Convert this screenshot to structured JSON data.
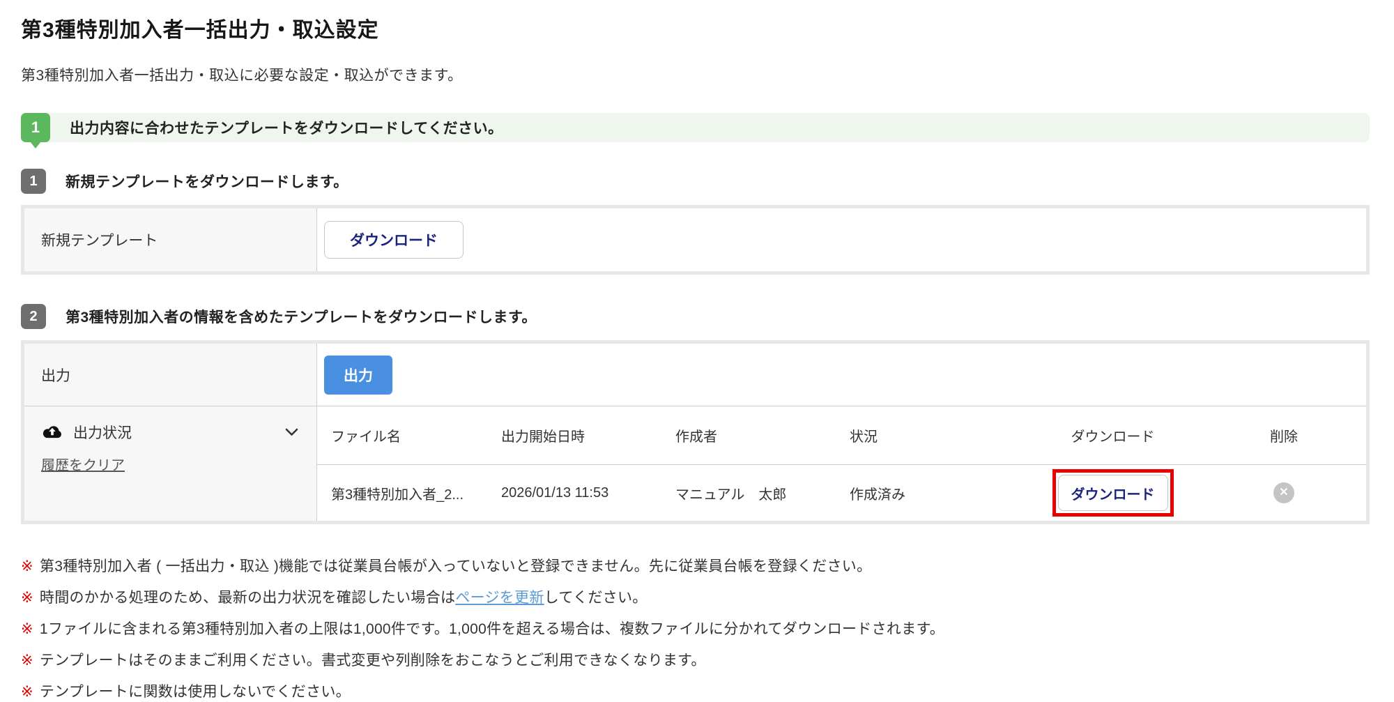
{
  "page": {
    "title": "第3種特別加入者一括出力・取込設定",
    "subtitle": "第3種特別加入者一括出力・取込に必要な設定・取込ができます。"
  },
  "banner": {
    "step": "1",
    "text": "出力内容に合わせたテンプレートをダウンロードしてください。"
  },
  "section1": {
    "num": "1",
    "heading": "新規テンプレートをダウンロードします。",
    "label": "新規テンプレート",
    "download_button": "ダウンロード"
  },
  "section2": {
    "num": "2",
    "heading": "第3種特別加入者の情報を含めたテンプレートをダウンロードします。",
    "output_label": "出力",
    "output_button": "出力",
    "status_label": "出力状況",
    "clear_history_link": "履歴をクリア",
    "table": {
      "headers": [
        "ファイル名",
        "出力開始日時",
        "作成者",
        "状況",
        "ダウンロード",
        "削除"
      ],
      "row": {
        "file_name": "第3種特別加入者_2...",
        "started_at": "2026/01/13 11:53",
        "creator": "マニュアル　太郎",
        "status": "作成済み",
        "download_button": "ダウンロード",
        "delete_glyph": "✕"
      }
    }
  },
  "notes": {
    "marker": "※",
    "note1": "第3種特別加入者 ( 一括出力・取込 )機能では従業員台帳が入っていないと登録できません。先に従業員台帳を登録ください。",
    "note2_pre": "時間のかかる処理のため、最新の出力状況を確認したい場合は",
    "note2_link": "ページを更新",
    "note2_post": "してください。",
    "note3": "1ファイルに含まれる第3種特別加入者の上限は1,000件です。1,000件を超える場合は、複数ファイルに分かれてダウンロードされます。",
    "note4": "テンプレートはそのままご利用ください。書式変更や列削除をおこなうとご利用できなくなります。",
    "note5": "テンプレートに関数は使用しないでください。"
  },
  "colors": {
    "accent_green": "#5cb85c",
    "banner_bg": "#eef6ee",
    "badge_gray": "#6e6e6e",
    "primary_blue": "#4a90e2",
    "button_text_navy": "#1a237e",
    "highlight_red": "#e60000",
    "note_mark_red": "#dd0000",
    "link_blue": "#5b9bd5"
  }
}
